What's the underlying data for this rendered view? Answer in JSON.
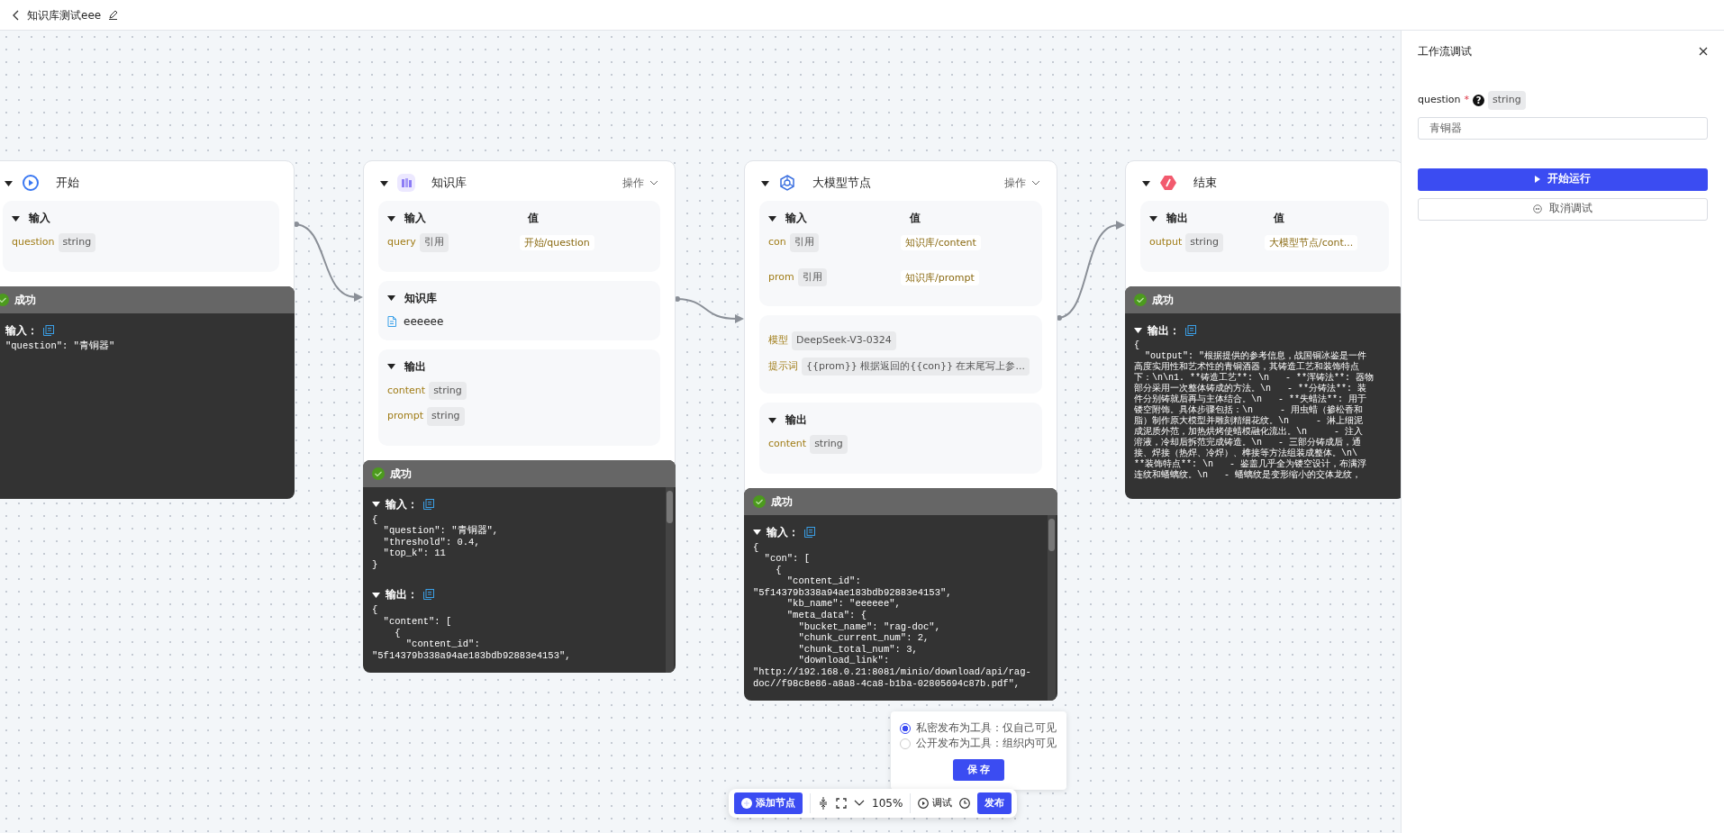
{
  "header": {
    "title": "知识库测试eee"
  },
  "canvas": {
    "nodes": [
      {
        "kind": "start",
        "title": "开始",
        "expanded": true,
        "sections": [
          {
            "kind": "params",
            "title": "输入",
            "expanded": true,
            "rows": [
              {
                "name": "question",
                "type": "string"
              }
            ]
          }
        ],
        "result": {
          "status": "成功",
          "blocks": [
            {
              "label": "输入：",
              "lines": [
                "\"question\": \"青铜器\""
              ]
            }
          ]
        }
      },
      {
        "kind": "knowledge",
        "title": "知识库",
        "expanded": true,
        "menu": "操作",
        "sections": [
          {
            "kind": "mapping",
            "title": "输入",
            "expanded": true,
            "value_header": "值",
            "rows": [
              {
                "name": "query",
                "type": "引用",
                "value": "开始/question"
              }
            ]
          },
          {
            "kind": "files",
            "title": "知识库",
            "expanded": true,
            "items": [
              "eeeeee"
            ]
          },
          {
            "kind": "params",
            "title": "输出",
            "expanded": true,
            "rows": [
              {
                "name": "content",
                "type": "string"
              },
              {
                "name": "prompt",
                "type": "string"
              }
            ]
          }
        ],
        "result": {
          "status": "成功",
          "blocks": [
            {
              "label": "输入：",
              "expanded": true,
              "lines": [
                "{",
                "  \"question\": \"青铜器\",",
                "  \"threshold\": 0.4,",
                "  \"top_k\": 11",
                "}"
              ]
            },
            {
              "label": "输出：",
              "expanded": true,
              "lines": [
                "{",
                "  \"content\": [",
                "    {",
                "      \"content_id\":",
                "\"5f14379b338a94ae183bdb92883e4153\","
              ]
            }
          ]
        }
      },
      {
        "kind": "llm",
        "title": "大模型节点",
        "expanded": true,
        "menu": "操作",
        "sections": [
          {
            "kind": "mapping",
            "title": "输入",
            "expanded": true,
            "value_header": "值",
            "rows": [
              {
                "name": "con",
                "type": "引用",
                "value": "知识库/content"
              },
              {
                "name": "prom",
                "type": "引用",
                "value": "知识库/prompt"
              }
            ]
          },
          {
            "kind": "settings",
            "rows": [
              {
                "label": "模型",
                "value": "DeepSeek-V3-0324"
              },
              {
                "label": "提示词",
                "value": "{{prom}} 根据返回的{{con}} 在末尾写上参..."
              }
            ]
          },
          {
            "kind": "params",
            "title": "输出",
            "expanded": true,
            "rows": [
              {
                "name": "content",
                "type": "string"
              }
            ]
          }
        ],
        "result": {
          "status": "成功",
          "blocks": [
            {
              "label": "输入：",
              "expanded": true,
              "lines": [
                "{",
                "  \"con\": [",
                "    {",
                "      \"content_id\":",
                "\"5f14379b338a94ae183bdb92883e4153\",",
                "      \"kb_name\": \"eeeeee\",",
                "      \"meta_data\": {",
                "        \"bucket_name\": \"rag-doc\",",
                "        \"chunk_current_num\": 2,",
                "        \"chunk_total_num\": 3,",
                "        \"download_link\":",
                "\"http://192.168.0.21:8081/minio/download/api/rag-",
                "doc//f98c8e86-a8a8-4ca8-b1ba-02805694c87b.pdf\","
              ]
            }
          ]
        }
      },
      {
        "kind": "end",
        "title": "结束",
        "expanded": true,
        "sections": [
          {
            "kind": "mapping",
            "title": "输出",
            "expanded": true,
            "value_header": "值",
            "rows": [
              {
                "name": "output",
                "type": "string",
                "value": "大模型节点/cont..."
              }
            ]
          }
        ],
        "result": {
          "status": "成功",
          "blocks": [
            {
              "label": "输出：",
              "expanded": true,
              "lines": [
                "{",
                "  \"output\": \"根据提供的参考信息，战国铜冰鉴是一件",
                "高度实用性和艺术性的青铜酒器，其铸造工艺和装饰特点",
                "下：\\n\\n1. **铸造工艺**: \\n   - **浑铸法**: 器物",
                "部分采用一次整体铸成的方法。\\n   - **分铸法**: 装",
                "件分别铸就后再与主体结合。\\n   - **失蜡法**: 用于",
                "镂空附饰。具体步骤包括：\\n     - 用虫蜡（掺松香和",
                "脂）制作原大模型并雕刻精细花纹。\\n     - 淋上细泥",
                "成泥质外范，加热烘烤使蜡模融化流出。\\n     - 注入",
                "溶液，冷却后拆范完成铸造。\\n   - 三部分铸成后，通",
                "接、焊接（热焊、冷焊）、榫接等方法组装成整体。\\n\\",
                "**装饰特点**: \\n   - 鉴盖几乎全为镂空设计，布满浮",
                "连纹和蟠螭纹。\\n   - 蟠螭纹是变形缩小的交体龙纹，"
              ]
            }
          ]
        }
      }
    ],
    "publish": {
      "options": [
        {
          "label": "私密发布为工具：仅自己可见",
          "selected": true
        },
        {
          "label": "公开发布为工具：组织内可见",
          "selected": false
        }
      ],
      "save": "保 存"
    },
    "toolbar": {
      "add": "添加节点",
      "zoom": "105%",
      "debug": "调试",
      "publish": "发布"
    }
  },
  "debug_panel": {
    "title": "工作流调试",
    "field": {
      "label": "question",
      "required": "*",
      "help": "?",
      "type": "string",
      "value": "青铜器"
    },
    "run": "开始运行",
    "cancel": "取消调试"
  }
}
